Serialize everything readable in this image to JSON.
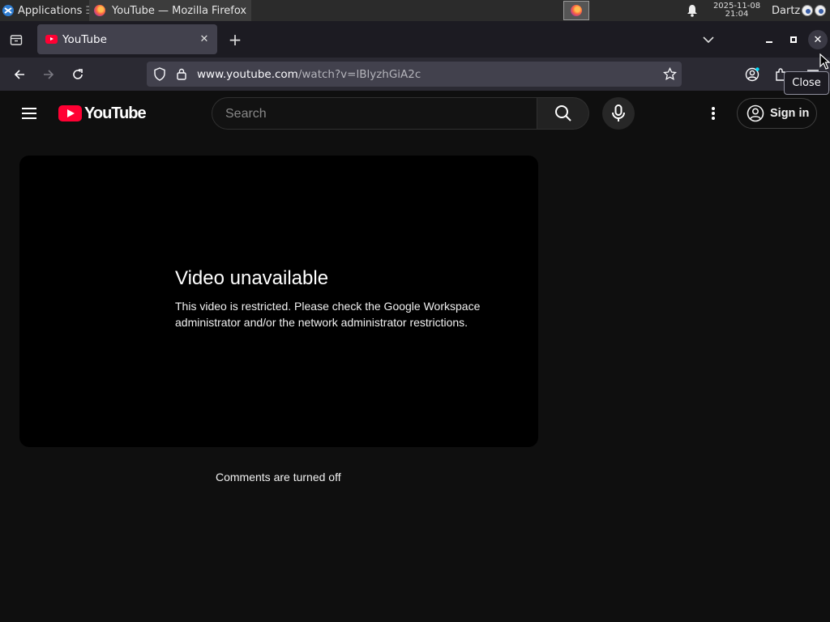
{
  "panel": {
    "applications_label": "Applications",
    "task_title": "YouTube — Mozilla Firefox",
    "clock_date": "2025-11-08",
    "clock_time": "21:04",
    "user_name": "Dartz"
  },
  "browser": {
    "tab_title": "YouTube",
    "url_host": "www.youtube.com",
    "url_path": "/watch?v=lBlyzhGiA2c",
    "tooltip": "Close"
  },
  "youtube": {
    "logo_text": "YouTube",
    "search_placeholder": "Search",
    "signin_label": "Sign in",
    "error_title": "Video unavailable",
    "error_message": "This video is restricted. Please check the Google Workspace administrator and/or the network administrator restrictions.",
    "comments_status": "Comments are turned off"
  },
  "colors": {
    "yt_red": "#ff0033",
    "page_bg": "#0f0f0f",
    "toolbar_bg": "#2b2a33",
    "tab_active": "#42414d"
  }
}
